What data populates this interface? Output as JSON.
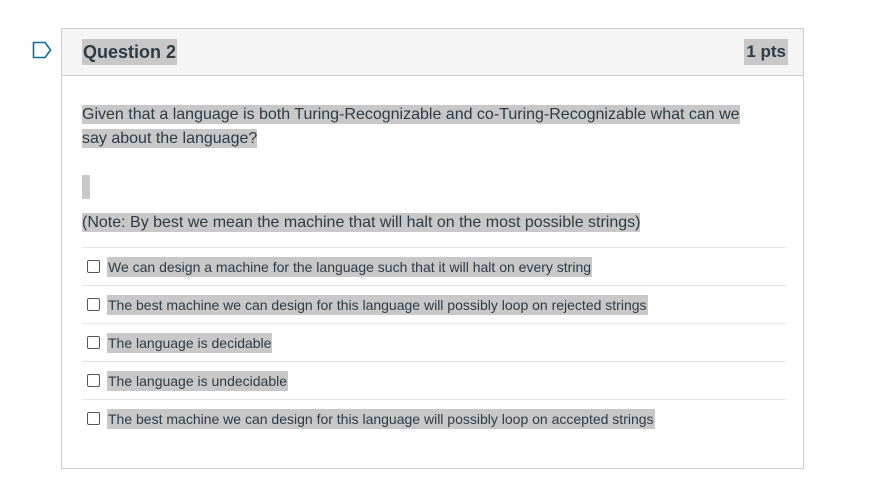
{
  "question": {
    "title": "Question 2",
    "points": "1 pts",
    "prompt": "Given that a language is both Turing-Recognizable and co-Turing-Recognizable what can we say about the language?",
    "note": "(Note: By best we mean the machine that will halt on the most possible strings)",
    "answers": [
      {
        "label": "We can design a machine for the language such that it will halt on every string",
        "checked": false
      },
      {
        "label": "The best machine we can design for this language will possibly loop on rejected strings",
        "checked": false
      },
      {
        "label": "The language is decidable",
        "checked": false
      },
      {
        "label": "The language is undecidable",
        "checked": false
      },
      {
        "label": "The best machine we can design for this language will possibly loop on accepted strings",
        "checked": false
      }
    ]
  },
  "icons": {
    "flag": "flag-outline-icon"
  },
  "colors": {
    "text": "#2d3b45",
    "highlight": "#c8c8c8",
    "header_bg": "#f5f5f5",
    "border": "#c7cdd1",
    "flag": "#0770a3"
  }
}
